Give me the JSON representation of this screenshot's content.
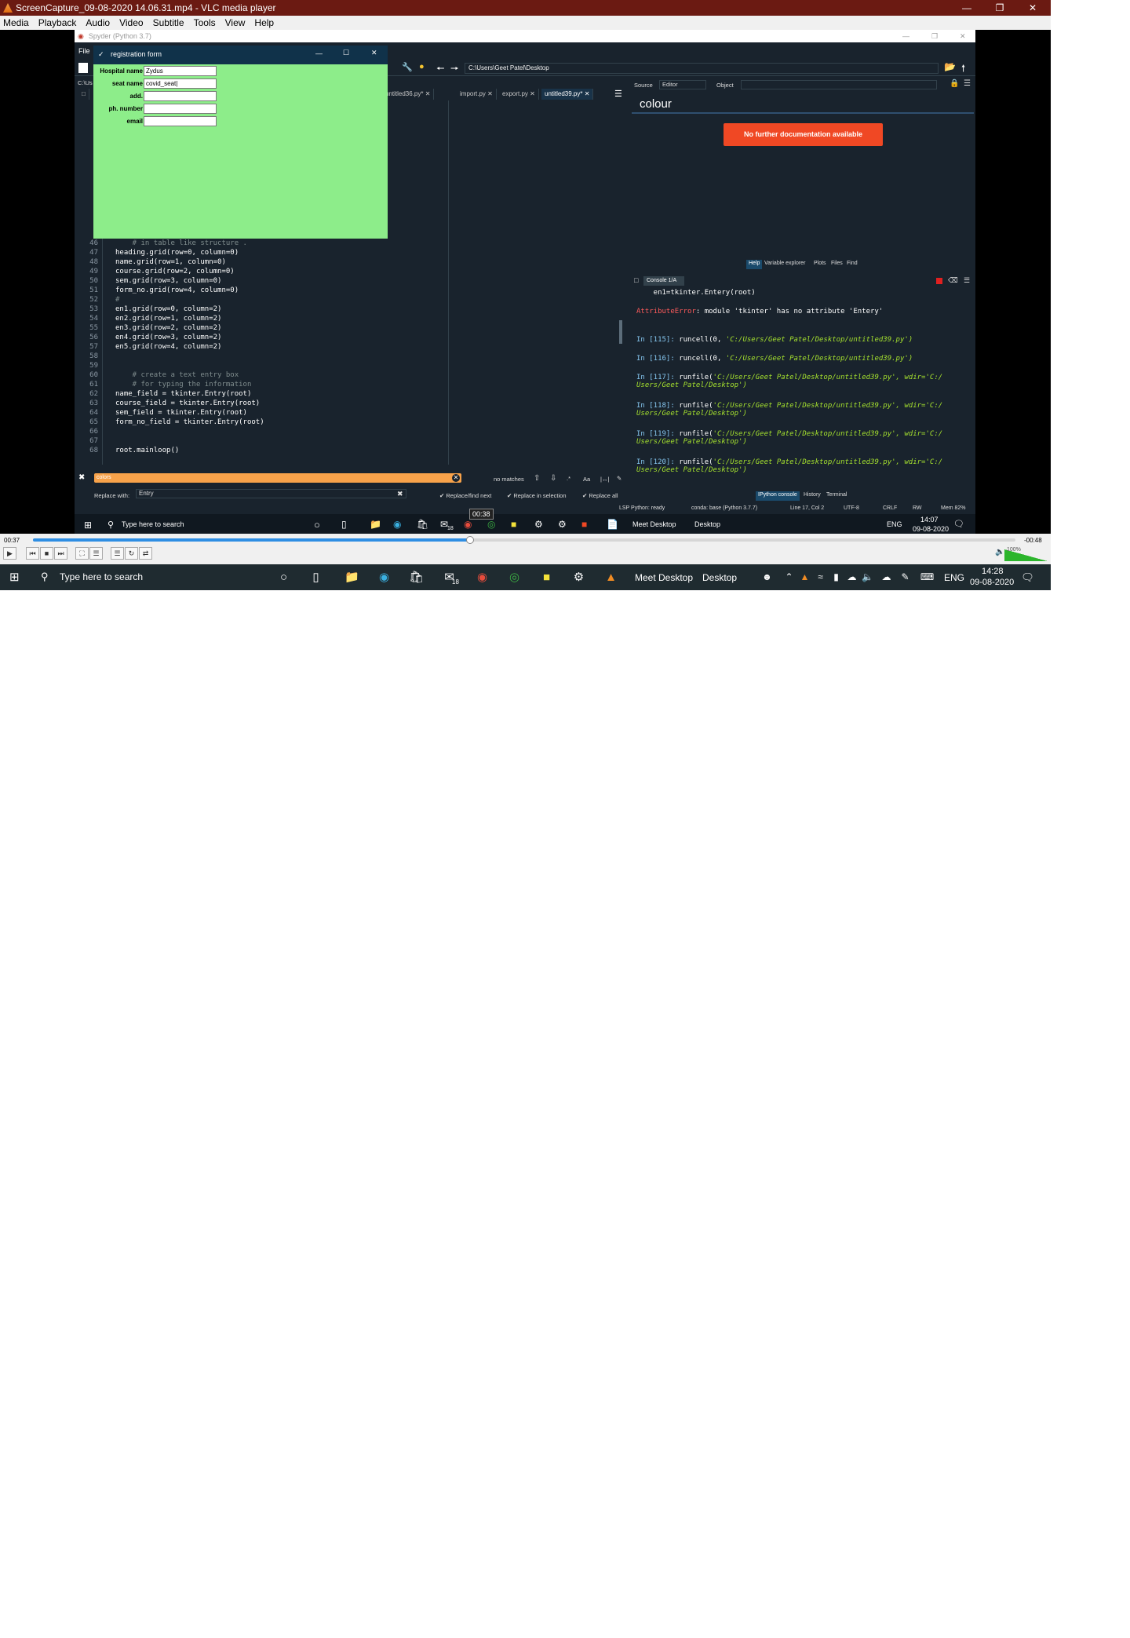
{
  "vlc": {
    "title": "ScreenCapture_09-08-2020 14.06.31.mp4 - VLC media player",
    "menu": [
      "Media",
      "Playback",
      "Audio",
      "Video",
      "Subtitle",
      "Tools",
      "View",
      "Help"
    ],
    "time_elapsed": "00:37",
    "time_remaining": "-00:48",
    "seek_tooltip": "00:38",
    "progress": 0.445,
    "volume_label": "100%"
  },
  "spyder": {
    "title": "Spyder (Python 3.7)",
    "menu_file": "File",
    "path": "C:\\Users\\Geet Patel\\Desktop",
    "path_short": "C:\\Us",
    "tabs": [
      "untitled36.py*",
      "import.py",
      "export.py",
      "untitled39.py*"
    ],
    "active_tab": "untitled39.py*",
    "editor_lines": [
      {
        "n": "46",
        "code": "    # in table like structure ."
      },
      {
        "n": "47",
        "code": "heading.grid(row=0, column=0)"
      },
      {
        "n": "48",
        "code": "name.grid(row=1, column=0)"
      },
      {
        "n": "49",
        "code": "course.grid(row=2, column=0)"
      },
      {
        "n": "50",
        "code": "sem.grid(row=3, column=0)"
      },
      {
        "n": "51",
        "code": "form_no.grid(row=4, column=0)"
      },
      {
        "n": "52",
        "code": "#"
      },
      {
        "n": "53",
        "code": "en1.grid(row=0, column=2)"
      },
      {
        "n": "54",
        "code": "en2.grid(row=1, column=2)"
      },
      {
        "n": "55",
        "code": "en3.grid(row=2, column=2)"
      },
      {
        "n": "56",
        "code": "en4.grid(row=3, column=2)"
      },
      {
        "n": "57",
        "code": "en5.grid(row=4, column=2)"
      },
      {
        "n": "58",
        "code": ""
      },
      {
        "n": "59",
        "code": ""
      },
      {
        "n": "60",
        "code": "    # create a text entry box"
      },
      {
        "n": "61",
        "code": "    # for typing the information"
      },
      {
        "n": "62",
        "code": "name_field = tkinter.Entry(root)"
      },
      {
        "n": "63",
        "code": "course_field = tkinter.Entry(root)"
      },
      {
        "n": "64",
        "code": "sem_field = tkinter.Entry(root)"
      },
      {
        "n": "65",
        "code": "form_no_field = tkinter.Entry(root)"
      },
      {
        "n": "66",
        "code": ""
      },
      {
        "n": "67",
        "code": ""
      },
      {
        "n": "68",
        "code": "root.mainloop()"
      }
    ],
    "find": {
      "search_value": "colors",
      "no_matches": "no matches",
      "replace_label": "Replace with:",
      "replace_value": "Entry",
      "replace_find_next": "Replace/find next",
      "replace_in_selection": "Replace in selection",
      "replace_all": "Replace all",
      "case_btn": "Aa"
    },
    "help": {
      "source_label": "Source",
      "source_value": "Editor",
      "object_label": "Object",
      "heading": "colour",
      "message": "No further documentation available",
      "tabs": [
        "Help",
        "Variable explorer",
        "Plots",
        "Files",
        "Find"
      ]
    },
    "console": {
      "tab": "Console 1/A",
      "lines": [
        {
          "type": "plain",
          "text": "    en1=tkinter.Entery(root)"
        },
        {
          "type": "error",
          "label": "AttributeError",
          "text": ": module 'tkinter' has no attribute 'Entery'"
        },
        {
          "type": "prompt",
          "prompt": "In [115]: ",
          "text": "runcell(0, ",
          "str": "'C:/Users/Geet Patel/Desktop/untitled39.py'",
          "end": ")"
        },
        {
          "type": "prompt",
          "prompt": "In [116]: ",
          "text": "runcell(0, ",
          "str": "'C:/Users/Geet Patel/Desktop/untitled39.py'",
          "end": ")"
        },
        {
          "type": "prompt",
          "prompt": "In [117]: ",
          "text": "runfile(",
          "str": "'C:/Users/Geet Patel/Desktop/untitled39.py'",
          "end": ", wdir='C:/",
          "cont": "Users/Geet Patel/Desktop')"
        },
        {
          "type": "prompt",
          "prompt": "In [118]: ",
          "text": "runfile(",
          "str": "'C:/Users/Geet Patel/Desktop/untitled39.py'",
          "end": ", wdir='C:/",
          "cont": "Users/Geet Patel/Desktop')"
        },
        {
          "type": "prompt",
          "prompt": "In [119]: ",
          "text": "runfile(",
          "str": "'C:/Users/Geet Patel/Desktop/untitled39.py'",
          "end": ", wdir='C:/",
          "cont": "Users/Geet Patel/Desktop')"
        },
        {
          "type": "prompt",
          "prompt": "In [120]: ",
          "text": "runfile(",
          "str": "'C:/Users/Geet Patel/Desktop/untitled39.py'",
          "end": ", wdir='C:/",
          "cont": "Users/Geet Patel/Desktop')"
        }
      ],
      "bottom_tabs": [
        "IPython console",
        "History",
        "Terminal"
      ]
    },
    "status": {
      "lsp": "LSP Python: ready",
      "conda": "conda: base (Python 3.7.7)",
      "pos": "Line 17, Col 2",
      "enc": "UTF-8",
      "eol": "CRLF",
      "rw": "RW",
      "mem": "Mem 82%"
    }
  },
  "reg_form": {
    "title": "registration form",
    "fields": [
      {
        "label": "Hospital name",
        "value": "Zydus"
      },
      {
        "label": "seat name",
        "value": "covid_seat|"
      },
      {
        "label": "add.",
        "value": ""
      },
      {
        "label": "ph. number",
        "value": ""
      },
      {
        "label": "email",
        "value": ""
      }
    ]
  },
  "inner_taskbar": {
    "search_placeholder": "Type here to search",
    "meet_desktop": "Meet Desktop",
    "desktop": "Desktop",
    "lang": "ENG",
    "time": "14:07",
    "date": "09-08-2020",
    "badge": "18"
  },
  "taskbar": {
    "search_placeholder": "Type here to search",
    "meet_desktop": "Meet Desktop",
    "desktop": "Desktop",
    "lang": "ENG",
    "time": "14:28",
    "date": "09-08-2020",
    "badge": "18"
  },
  "colors": {
    "vlc_title": "#6b1a12",
    "spyder_bg": "#19232d",
    "form_green": "#8ded8a",
    "nodoc_red": "#f04824",
    "find_orange": "#f7a24a",
    "seek_blue": "#2e8ee3"
  }
}
